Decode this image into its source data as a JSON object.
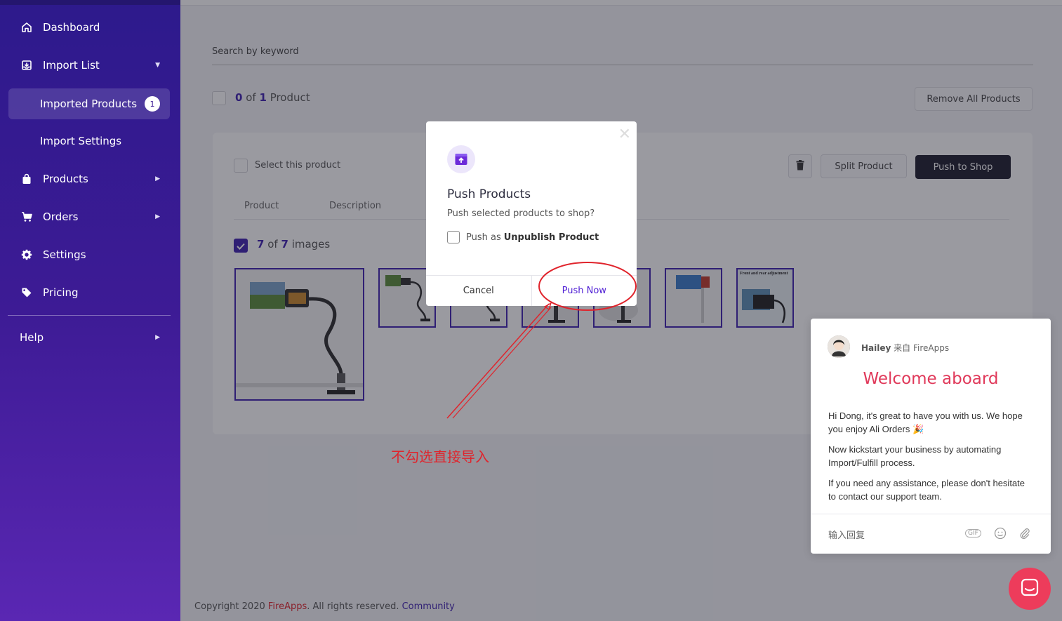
{
  "sidebar": {
    "items": [
      {
        "label": "Dashboard",
        "icon": "home-icon"
      },
      {
        "label": "Import List",
        "icon": "import-list-icon"
      },
      {
        "label": "Imported Products",
        "badge": "1"
      },
      {
        "label": "Import Settings"
      },
      {
        "label": "Products",
        "icon": "bag-icon"
      },
      {
        "label": "Orders",
        "icon": "cart-icon"
      },
      {
        "label": "Settings",
        "icon": "gear-icon"
      },
      {
        "label": "Pricing",
        "icon": "tag-icon"
      },
      {
        "label": "Help"
      }
    ]
  },
  "main": {
    "search_placeholder": "Search by keyword",
    "count": {
      "selected": "0",
      "of": "of",
      "total": "1",
      "unit": "Product"
    },
    "remove_all_label": "Remove All Products",
    "card": {
      "select_label": "Select this product",
      "split_label": "Split Product",
      "push_label": "Push to Shop",
      "tabs": [
        "Product",
        "Description"
      ],
      "images": {
        "selected": "7",
        "of": "of",
        "total": "7",
        "unit": "images"
      },
      "thumb_caption": "Front and rear adjustment"
    }
  },
  "footer": {
    "copyright": "Copyright 2020 ",
    "brand": "FireApps",
    "rights": ". All rights reserved. ",
    "community": "Community"
  },
  "modal": {
    "title": "Push Products",
    "description": "Push selected products to shop?",
    "option_prefix": "Push as ",
    "option_bold": "Unpublish Product",
    "cancel_label": "Cancel",
    "push_now_label": "Push Now"
  },
  "annotation": {
    "text": "不勾选直接导入",
    "color": "#e0242c"
  },
  "chat": {
    "agent": "Hailey",
    "from": " 来自 FireApps",
    "title": "Welcome aboard",
    "p1": "Hi Dong, it's great to have you with us. We hope you enjoy Ali Orders 🎉",
    "p2": "Now kickstart your business by automating Import/Fulfill process.",
    "p3": "If you need any assistance, please don't hesitate to contact our support team.",
    "input_placeholder": "输入回复",
    "gif_label": "GIF"
  },
  "colors": {
    "accent": "#3d1fb0",
    "chat_accent": "#e0395a",
    "dark_button": "#1d1d2c"
  }
}
